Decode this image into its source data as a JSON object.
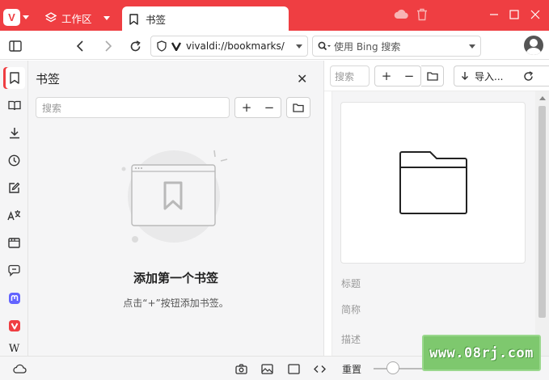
{
  "tabbar": {
    "workspace_label": "工作区",
    "active_tab_title": "书签",
    "new_tab_symbol": "+"
  },
  "addressbar": {
    "url": "vivaldi://bookmarks/",
    "search_placeholder": "使用 Bing 搜索"
  },
  "sidebar": {
    "icons": [
      "bookmark-icon",
      "reading-list-icon",
      "downloads-icon",
      "history-icon",
      "notes-icon",
      "translate-icon",
      "window-icon",
      "chat-icon",
      "mastodon-icon",
      "vivaldi-icon",
      "wikipedia-icon"
    ],
    "wiki_letter": "W"
  },
  "bookmark_panel": {
    "title": "书签",
    "filter_placeholder": "搜索",
    "add_symbol": "+",
    "remove_symbol": "−",
    "empty_title": "添加第一个书签",
    "empty_hint": "点击“+”按钮添加书签。"
  },
  "manager": {
    "search_placeholder": "搜索",
    "add_symbol": "+",
    "remove_symbol": "−",
    "import_label": "导入...",
    "fields": {
      "title_label": "标题",
      "nickname_label": "简称",
      "description_label": "描述"
    }
  },
  "statusbar": {
    "reset_label": "重置"
  },
  "watermark": {
    "text": "www.08rj.com"
  },
  "colors": {
    "brand": "#ef3e42",
    "panel_bg": "#f5f5f6",
    "mastodon": "#6364ff"
  }
}
